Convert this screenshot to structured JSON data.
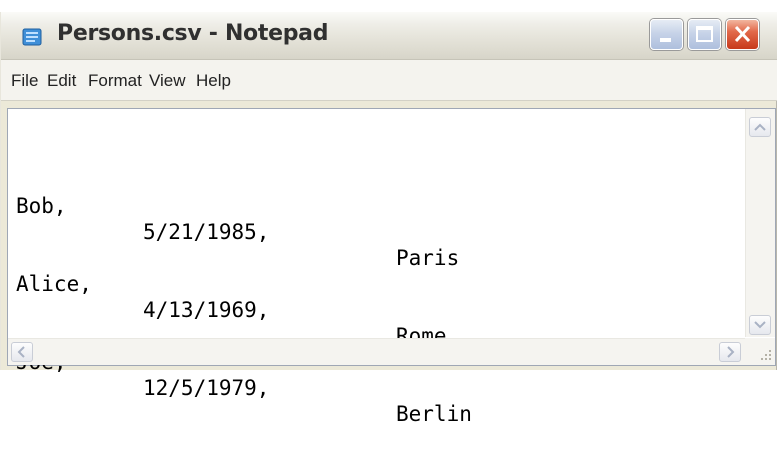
{
  "window": {
    "title": "Persons.csv - Notepad",
    "icon": "notepad-icon",
    "controls": {
      "minimize": "minimize-icon",
      "maximize": "maximize-icon",
      "close": "close-icon"
    }
  },
  "menu": [
    "File",
    "Edit",
    "Format",
    "View",
    "Help"
  ],
  "document": {
    "rows": [
      [
        "Bob,",
        "5/21/1985,",
        "Paris"
      ],
      [
        "Alice,",
        "4/13/1969,",
        "Rome"
      ],
      [
        "Joe,",
        "12/5/1979,",
        "Berlin"
      ]
    ]
  },
  "colors": {
    "close": "#d9482a",
    "menubar": "#f4f3ee",
    "editor_bg": "#ffffff",
    "text": "#000000"
  }
}
